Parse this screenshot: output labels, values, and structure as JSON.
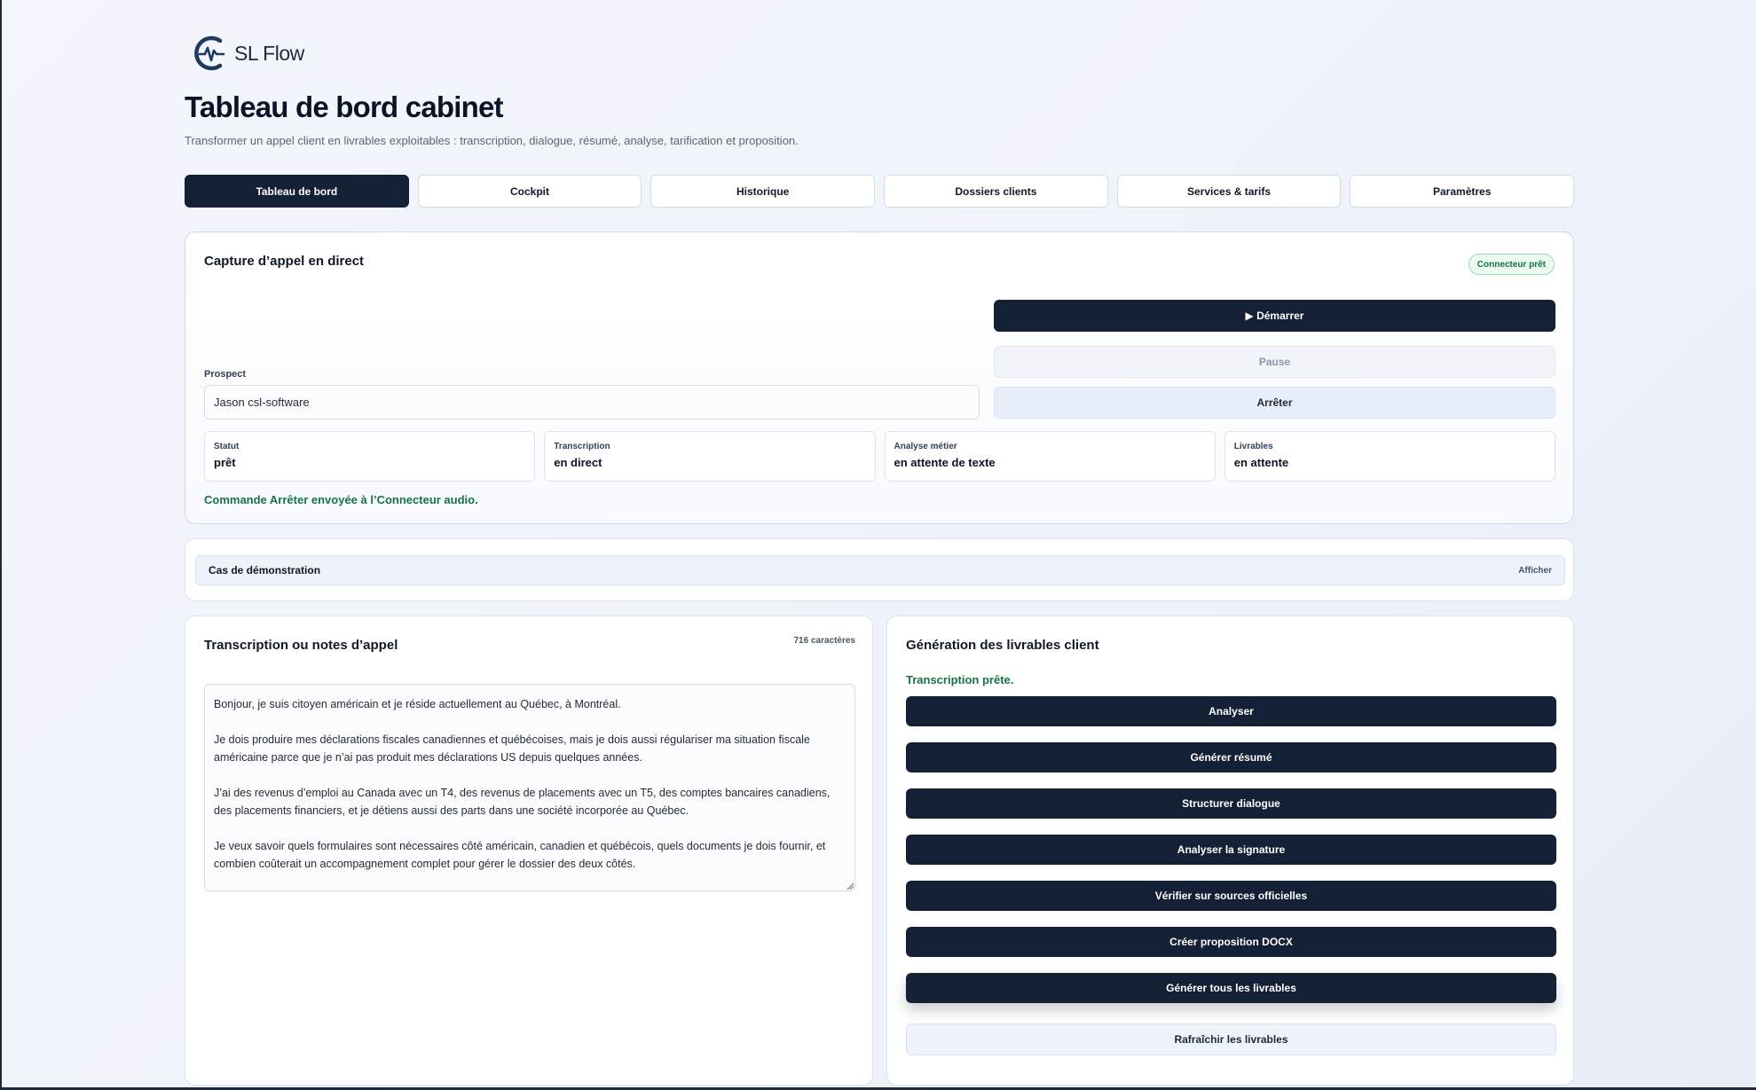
{
  "brand": {
    "name": "SL Flow"
  },
  "page": {
    "title": "Tableau de bord cabinet",
    "subtitle": "Transformer un appel client en livrables exploitables : transcription, dialogue, résumé, analyse, tarification et proposition."
  },
  "tabs": [
    {
      "label": "Tableau de bord",
      "active": true
    },
    {
      "label": "Cockpit",
      "active": false
    },
    {
      "label": "Historique",
      "active": false
    },
    {
      "label": "Dossiers clients",
      "active": false
    },
    {
      "label": "Services & tarifs",
      "active": false
    },
    {
      "label": "Paramètres",
      "active": false
    }
  ],
  "capture": {
    "title": "Capture d’appel en direct",
    "badge": "Connecteur prêt",
    "prospect_label": "Prospect",
    "prospect_value": "Jason csl-software",
    "start_label": "▶ Démarrer",
    "pause_label": "Pause",
    "stop_label": "Arrêter",
    "stats": [
      {
        "label": "Statut",
        "value": "prêt"
      },
      {
        "label": "Transcription",
        "value": "en direct"
      },
      {
        "label": "Analyse métier",
        "value": "en attente de texte"
      },
      {
        "label": "Livrables",
        "value": "en attente"
      }
    ],
    "notice": "Commande Arrêter envoyée à l’Connecteur audio."
  },
  "demo": {
    "title": "Cas de démonstration",
    "toggle": "Afficher"
  },
  "transcript": {
    "title": "Transcription ou notes d’appel",
    "count": "716 caractères",
    "text": "Bonjour, je suis citoyen américain et je réside actuellement au Québec, à Montréal.\n\nJe dois produire mes déclarations fiscales canadiennes et québécoises, mais je dois aussi régulariser ma situation fiscale américaine parce que je n’ai pas produit mes déclarations US depuis quelques années.\n\nJ’ai des revenus d’emploi au Canada avec un T4, des revenus de placements avec un T5, des comptes bancaires canadiens, des placements financiers, et je détiens aussi des parts dans une société incorporée au Québec.\n\nJe veux savoir quels formulaires sont nécessaires côté américain, canadien et québécois, quels documents je dois fournir, et combien coûterait un accompagnement complet pour gérer le dossier des deux côtés."
  },
  "deliverables": {
    "title": "Génération des livrables client",
    "status": "Transcription prête.",
    "buttons": [
      "Analyser",
      "Générer résumé",
      "Structurer dialogue",
      "Analyser la signature",
      "Vérifier sur sources officielles",
      "Créer proposition DOCX",
      "Générer tous les livrables"
    ],
    "refresh_label": "Rafraîchir les livrables"
  },
  "colors": {
    "primary": "#142036",
    "success": "#157347",
    "background": "#f3f6fc"
  },
  "icons": {
    "logo": "pulse-c-logo-icon",
    "resize": "resize-grip-icon"
  }
}
